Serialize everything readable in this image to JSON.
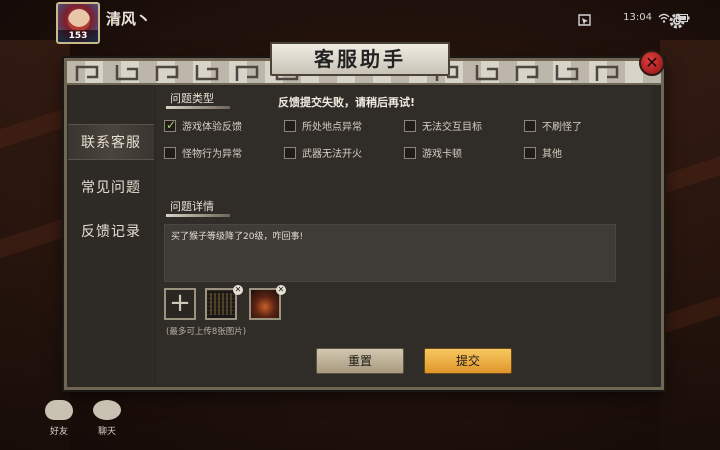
{
  "player": {
    "name": "清风丶",
    "level": "153"
  },
  "status": {
    "time": "13:04"
  },
  "dialog": {
    "title": "客服助手",
    "close_label": "✕",
    "error_message": "反馈提交失败，请稍后再试!"
  },
  "nav": {
    "items": [
      {
        "label": "联系客服",
        "active": true
      },
      {
        "label": "常见问题",
        "active": false
      },
      {
        "label": "反馈记录",
        "active": false
      }
    ]
  },
  "form": {
    "type_label": "问题类型",
    "options": [
      {
        "label": "游戏体验反馈",
        "checked": true
      },
      {
        "label": "所处地点异常",
        "checked": false
      },
      {
        "label": "无法交互目标",
        "checked": false
      },
      {
        "label": "不刷怪了",
        "checked": false
      },
      {
        "label": "怪物行为异常",
        "checked": false
      },
      {
        "label": "武器无法开火",
        "checked": false
      },
      {
        "label": "游戏卡顿",
        "checked": false
      },
      {
        "label": "其他",
        "checked": false
      }
    ],
    "detail_label": "问题详情",
    "detail_text": "买了猴子等级降了20级，咋回事!",
    "upload_hint": "(最多可上传8张图片)",
    "add_label": "+",
    "remove_label": "✕"
  },
  "buttons": {
    "reset": "重置",
    "submit": "提交"
  },
  "bottom": {
    "friends": "好友",
    "chat": "聊天"
  },
  "colors": {
    "accent_submit": "#f0b84a",
    "check": "#9fd36a",
    "close_red": "#c42020"
  }
}
